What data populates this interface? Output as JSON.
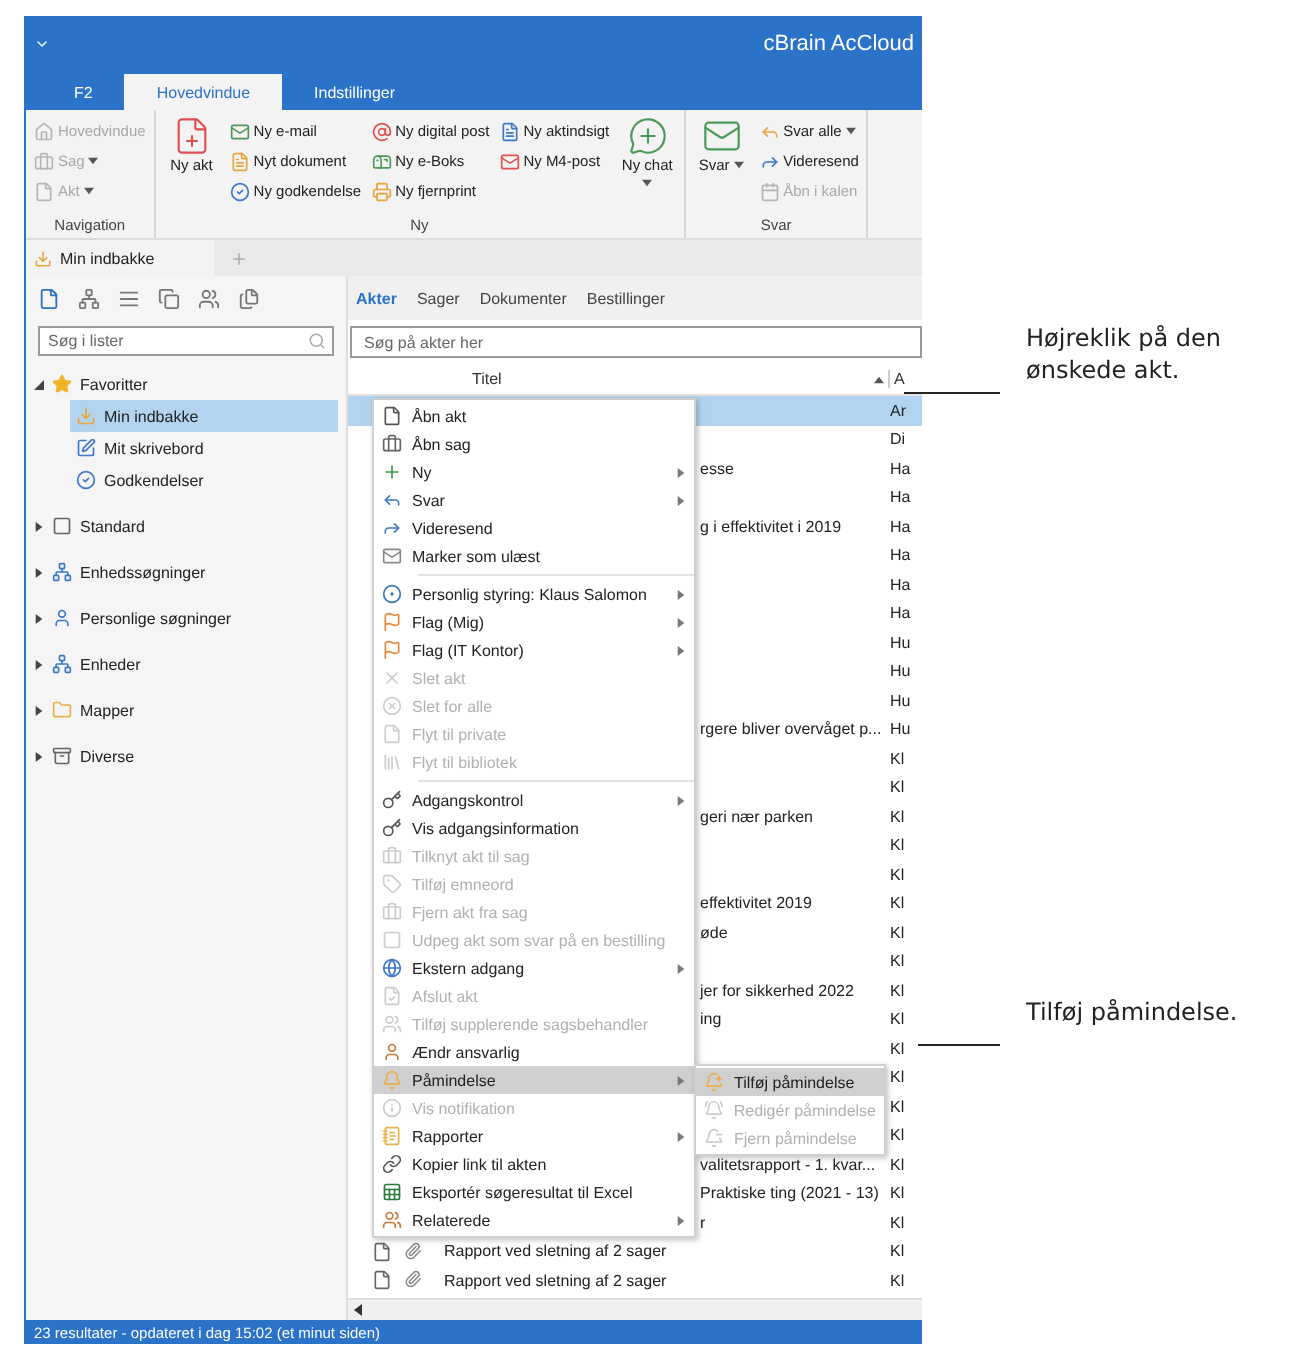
{
  "window": {
    "title": "cBrain AcCloud"
  },
  "ribbon_tabs": [
    {
      "label": "F2",
      "selected": false
    },
    {
      "label": "Hovedvindue",
      "selected": true
    },
    {
      "label": "Indstillinger",
      "selected": false
    }
  ],
  "ribbon_groups": [
    {
      "label": "Navigation",
      "buttons": [
        {
          "label": "Hovedvindue",
          "kind": "small",
          "disabled": true,
          "dropdown": false
        },
        {
          "label": "Sag",
          "kind": "small",
          "disabled": true,
          "dropdown": true
        },
        {
          "label": "Akt",
          "kind": "small",
          "disabled": true,
          "dropdown": true
        }
      ]
    },
    {
      "label": "Ny",
      "buttons": [
        {
          "label": "Ny akt",
          "kind": "large",
          "disabled": false,
          "dropdown": false
        },
        {
          "label": "Ny e-mail",
          "kind": "small",
          "disabled": false,
          "dropdown": false
        },
        {
          "label": "Nyt dokument",
          "kind": "small",
          "disabled": false,
          "dropdown": false
        },
        {
          "label": "Ny godkendelse",
          "kind": "small",
          "disabled": false,
          "dropdown": false
        },
        {
          "label": "Ny digital post",
          "kind": "small",
          "disabled": false,
          "dropdown": false
        },
        {
          "label": "Ny e-Boks",
          "kind": "small",
          "disabled": false,
          "dropdown": false
        },
        {
          "label": "Ny fjernprint",
          "kind": "small",
          "disabled": false,
          "dropdown": false
        },
        {
          "label": "Ny aktindsigt",
          "kind": "small",
          "disabled": false,
          "dropdown": false
        },
        {
          "label": "Ny M4-post",
          "kind": "small",
          "disabled": false,
          "dropdown": false
        },
        {
          "label": "Ny chat",
          "kind": "large",
          "disabled": false,
          "dropdown": true
        }
      ]
    },
    {
      "label": "Svar",
      "buttons": [
        {
          "label": "Svar",
          "kind": "large",
          "disabled": false,
          "dropdown": true
        },
        {
          "label": "Svar alle",
          "kind": "small",
          "disabled": false,
          "dropdown": true
        },
        {
          "label": "Videresend",
          "kind": "small",
          "disabled": false,
          "dropdown": false
        },
        {
          "label": "Åbn i kalen",
          "kind": "small",
          "disabled": true,
          "dropdown": false
        }
      ]
    }
  ],
  "doc_tabs": [
    {
      "label": "Min indbakke",
      "selected": true
    }
  ],
  "sidebar": {
    "search": {
      "placeholder": "Søg i lister"
    },
    "tree": [
      {
        "label": "Favoritter",
        "expanded": true,
        "selected": false,
        "children": [
          {
            "label": "Min indbakke",
            "selected": true
          },
          {
            "label": "Mit skrivebord",
            "selected": false
          },
          {
            "label": "Godkendelser",
            "selected": false
          }
        ]
      },
      {
        "label": "Standard",
        "expanded": false,
        "selected": false
      },
      {
        "label": "Enhedssøgninger",
        "expanded": false,
        "selected": false
      },
      {
        "label": "Personlige søgninger",
        "expanded": false,
        "selected": false
      },
      {
        "label": "Enheder",
        "expanded": false,
        "selected": false
      },
      {
        "label": "Mapper",
        "expanded": false,
        "selected": false
      },
      {
        "label": "Diverse",
        "expanded": false,
        "selected": false
      }
    ]
  },
  "list_tabs": [
    {
      "label": "Akter",
      "selected": true
    },
    {
      "label": "Sager",
      "selected": false
    },
    {
      "label": "Dokumenter",
      "selected": false
    },
    {
      "label": "Bestillinger",
      "selected": false
    }
  ],
  "list_search": {
    "placeholder": "Søg på akter her"
  },
  "table": {
    "columns": [
      "Titel",
      "A"
    ],
    "rows": [
      {
        "kind": "covered",
        "selected": true,
        "author": "Ar"
      },
      {
        "kind": "covered",
        "selected": false,
        "author": "Di"
      },
      {
        "kind": "covered",
        "selected": false,
        "title": "esse",
        "author": "Ha"
      },
      {
        "kind": "covered",
        "selected": false,
        "author": "Ha"
      },
      {
        "kind": "covered",
        "selected": false,
        "title": "g i effektivitet i 2019",
        "author": "Ha"
      },
      {
        "kind": "covered",
        "selected": false,
        "author": "Ha"
      },
      {
        "kind": "covered",
        "selected": false,
        "author": "Ha"
      },
      {
        "kind": "covered",
        "selected": false,
        "author": "Ha"
      },
      {
        "kind": "covered",
        "selected": false,
        "author": "Hu"
      },
      {
        "kind": "covered",
        "selected": false,
        "author": "Hu"
      },
      {
        "kind": "covered",
        "selected": false,
        "author": "Hu"
      },
      {
        "kind": "covered",
        "selected": false,
        "title": "rgere bliver overvåget p...",
        "author": "Hu"
      },
      {
        "kind": "covered",
        "selected": false,
        "author": "Kl"
      },
      {
        "kind": "covered",
        "selected": false,
        "author": "Kl"
      },
      {
        "kind": "covered",
        "selected": false,
        "title": "geri nær parken",
        "author": "Kl"
      },
      {
        "kind": "covered",
        "selected": false,
        "author": "Kl"
      },
      {
        "kind": "covered",
        "selected": false,
        "author": "Kl"
      },
      {
        "kind": "covered",
        "selected": false,
        "title": "effektivitet 2019",
        "author": "Kl"
      },
      {
        "kind": "covered",
        "selected": false,
        "title": "øde",
        "author": "Kl"
      },
      {
        "kind": "covered",
        "selected": false,
        "author": "Kl"
      },
      {
        "kind": "covered",
        "selected": false,
        "title": "jer for sikkerhed 2022",
        "author": "Kl"
      },
      {
        "kind": "covered",
        "selected": false,
        "title": "ing",
        "author": "Kl"
      },
      {
        "kind": "covered",
        "selected": false,
        "author": "Kl"
      },
      {
        "kind": "covered",
        "selected": false,
        "author": "Kl"
      },
      {
        "kind": "covered",
        "selected": false,
        "author": "Kl"
      },
      {
        "kind": "covered",
        "selected": false,
        "author": "Kl"
      },
      {
        "kind": "covered",
        "selected": false,
        "title": "valitetsrapport - 1. kvar...",
        "author": "Kl"
      },
      {
        "kind": "covered",
        "selected": false,
        "title": "Praktiske ting (2021 - 13)",
        "author": "Kl"
      },
      {
        "kind": "covered",
        "selected": false,
        "title": "r",
        "author": "Kl"
      },
      {
        "kind": "full",
        "selected": false,
        "title": "Rapport ved sletning af 2 sager",
        "author": "Kl"
      },
      {
        "kind": "full",
        "selected": false,
        "title": "Rapport ved sletning af 2 sager",
        "author": "Kl"
      }
    ]
  },
  "context_menu": [
    {
      "kind": "item",
      "label": "Åbn akt",
      "disabled": false,
      "submenu": false,
      "selected": false
    },
    {
      "kind": "item",
      "label": "Åbn sag",
      "disabled": false,
      "submenu": false,
      "selected": false
    },
    {
      "kind": "item",
      "label": "Ny",
      "disabled": false,
      "submenu": true,
      "selected": false
    },
    {
      "kind": "item",
      "label": "Svar",
      "disabled": false,
      "submenu": true,
      "selected": false
    },
    {
      "kind": "item",
      "label": "Videresend",
      "disabled": false,
      "submenu": false,
      "selected": false
    },
    {
      "kind": "item",
      "label": "Marker som ulæst",
      "disabled": false,
      "submenu": false,
      "selected": false
    },
    {
      "kind": "separator"
    },
    {
      "kind": "item",
      "label": "Personlig styring: Klaus Salomon",
      "disabled": false,
      "submenu": true,
      "selected": false
    },
    {
      "kind": "item",
      "label": "Flag (Mig)",
      "disabled": false,
      "submenu": true,
      "selected": false
    },
    {
      "kind": "item",
      "label": "Flag (IT Kontor)",
      "disabled": false,
      "submenu": true,
      "selected": false
    },
    {
      "kind": "item",
      "label": "Slet akt",
      "disabled": true,
      "submenu": false,
      "selected": false
    },
    {
      "kind": "item",
      "label": "Slet for alle",
      "disabled": true,
      "submenu": false,
      "selected": false
    },
    {
      "kind": "item",
      "label": "Flyt til private",
      "disabled": true,
      "submenu": false,
      "selected": false
    },
    {
      "kind": "item",
      "label": "Flyt til bibliotek",
      "disabled": true,
      "submenu": false,
      "selected": false
    },
    {
      "kind": "separator"
    },
    {
      "kind": "item",
      "label": "Adgangskontrol",
      "disabled": false,
      "submenu": true,
      "selected": false
    },
    {
      "kind": "item",
      "label": "Vis adgangsinformation",
      "disabled": false,
      "submenu": false,
      "selected": false
    },
    {
      "kind": "item",
      "label": "Tilknyt akt til sag",
      "disabled": true,
      "submenu": false,
      "selected": false
    },
    {
      "kind": "item",
      "label": "Tilføj emneord",
      "disabled": true,
      "submenu": false,
      "selected": false
    },
    {
      "kind": "item",
      "label": "Fjern akt fra sag",
      "disabled": true,
      "submenu": false,
      "selected": false
    },
    {
      "kind": "item",
      "label": "Udpeg akt som svar på en bestilling",
      "disabled": true,
      "submenu": false,
      "selected": false
    },
    {
      "kind": "item",
      "label": "Ekstern adgang",
      "disabled": false,
      "submenu": true,
      "selected": false
    },
    {
      "kind": "item",
      "label": "Afslut akt",
      "disabled": true,
      "submenu": false,
      "selected": false
    },
    {
      "kind": "item",
      "label": "Tilføj supplerende sagsbehandler",
      "disabled": true,
      "submenu": false,
      "selected": false
    },
    {
      "kind": "item",
      "label": "Ændr ansvarlig",
      "disabled": false,
      "submenu": false,
      "selected": false
    },
    {
      "kind": "item",
      "label": "Påmindelse",
      "disabled": false,
      "submenu": true,
      "selected": true,
      "children": [
        {
          "label": "Tilføj påmindelse",
          "disabled": false,
          "selected": true
        },
        {
          "label": "Redigér påmindelse",
          "disabled": true,
          "selected": false
        },
        {
          "label": "Fjern påmindelse",
          "disabled": true,
          "selected": false
        }
      ]
    },
    {
      "kind": "item",
      "label": "Vis notifikation",
      "disabled": true,
      "submenu": false,
      "selected": false
    },
    {
      "kind": "item",
      "label": "Rapporter",
      "disabled": false,
      "submenu": true,
      "selected": false
    },
    {
      "kind": "item",
      "label": "Kopier link til akten",
      "disabled": false,
      "submenu": false,
      "selected": false
    },
    {
      "kind": "item",
      "label": "Eksportér søgeresultat til Excel",
      "disabled": false,
      "submenu": false,
      "selected": false
    },
    {
      "kind": "item",
      "label": "Relaterede",
      "disabled": false,
      "submenu": true,
      "selected": false
    }
  ],
  "status_bar": "23 resultater - opdateret i dag 15:02 (et minut siden)",
  "annotations": [
    {
      "text": "Højreklik på den ønskede akt."
    },
    {
      "text": "Tilføj påmindelse."
    }
  ]
}
